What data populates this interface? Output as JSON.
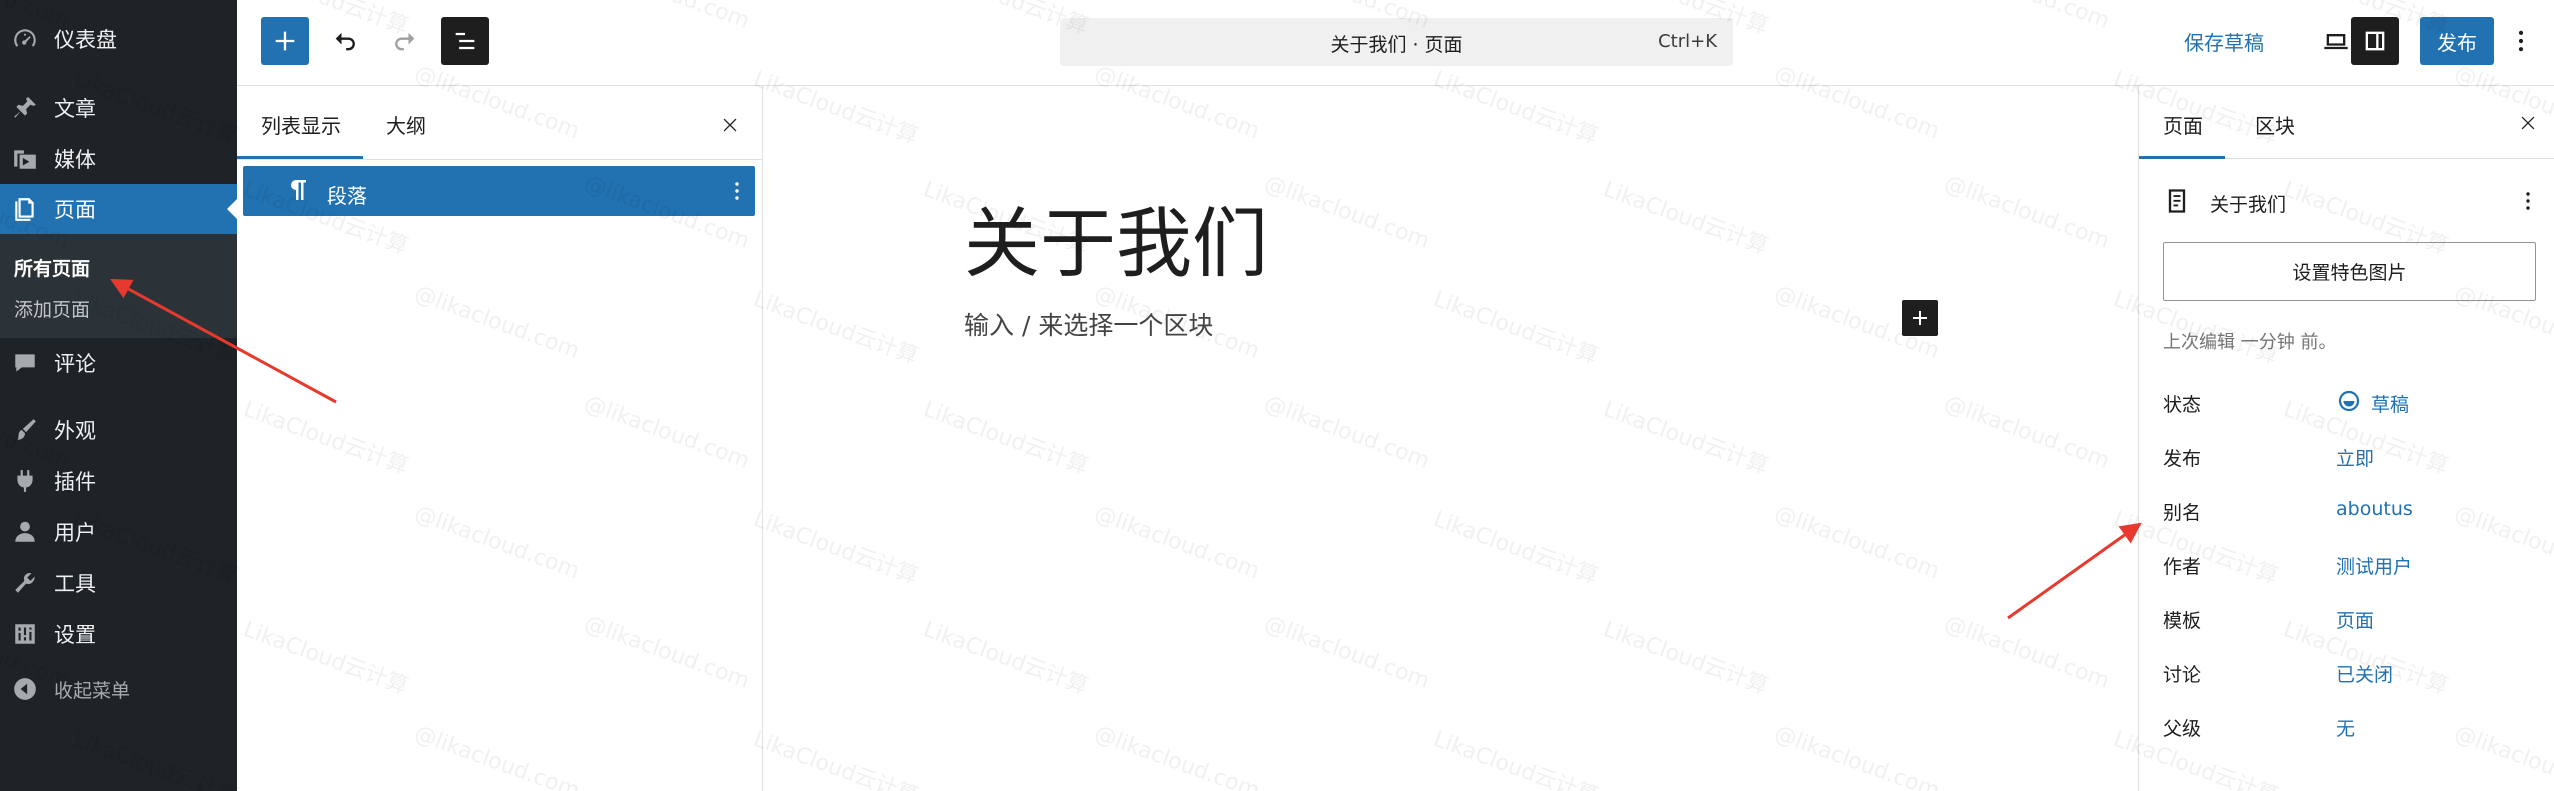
{
  "admin_menu": {
    "dashboard": "仪表盘",
    "posts": "文章",
    "media": "媒体",
    "pages": "页面",
    "pages_submenu": [
      "所有页面",
      "添加页面"
    ],
    "comments": "评论",
    "appearance": "外观",
    "plugins": "插件",
    "users": "用户",
    "tools": "工具",
    "settings": "设置",
    "collapse": "收起菜单"
  },
  "toolbar": {
    "command_title": "关于我们 · 页面",
    "command_shortcut": "Ctrl+K",
    "save_draft": "保存草稿",
    "publish": "发布"
  },
  "list_view": {
    "tabs": [
      "列表显示",
      "大纲"
    ],
    "active_tab": "列表显示",
    "block_label": "段落"
  },
  "canvas": {
    "title": "关于我们",
    "placeholder": "输入 / 来选择一个区块"
  },
  "settings_panel": {
    "tabs": [
      "页面",
      "区块"
    ],
    "active_tab": "页面",
    "doc_title": "关于我们",
    "featured_image_button": "设置特色图片",
    "last_edited": "上次编辑 一分钟 前。",
    "rows": [
      {
        "label": "状态",
        "value": "草稿"
      },
      {
        "label": "发布",
        "value": "立即"
      },
      {
        "label": "别名",
        "value": "aboutus"
      },
      {
        "label": "作者",
        "value": "测试用户"
      },
      {
        "label": "模板",
        "value": "页面"
      },
      {
        "label": "讨论",
        "value": "已关闭"
      },
      {
        "label": "父级",
        "value": "无"
      }
    ]
  },
  "watermark": {
    "text_a": "LikaCloud云计算",
    "text_b": "@likacloud.com"
  },
  "colors": {
    "admin_bg": "#1d2327",
    "accent": "#2271b1",
    "annotation_arrow": "#e8392f"
  }
}
